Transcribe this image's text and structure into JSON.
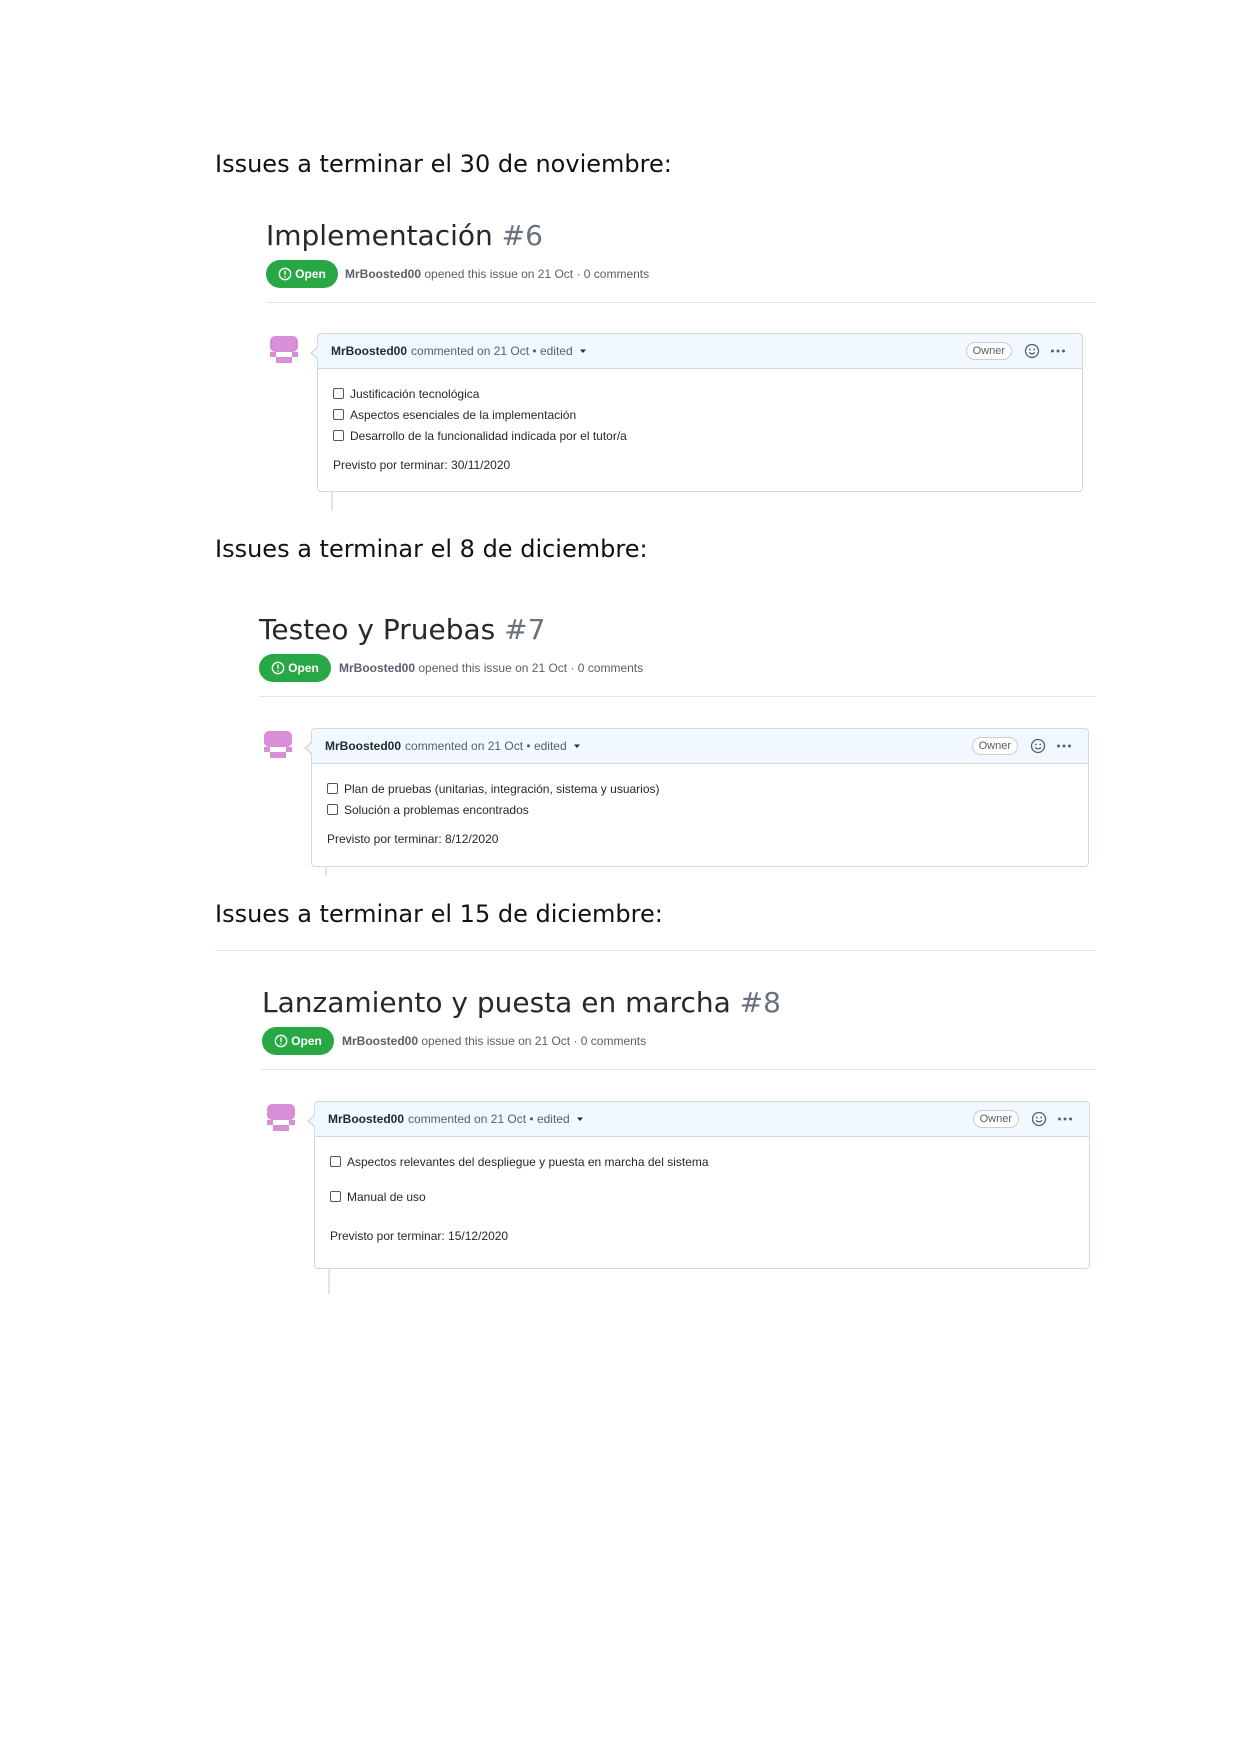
{
  "sections": [
    {
      "heading": "Issues a terminar el 30 de noviembre:",
      "issue": {
        "title": "Implementación",
        "number": "#6",
        "state": "Open",
        "author": "MrBoosted00",
        "meta": "opened this issue on 21 Oct · 0 comments",
        "comment_date": "commented on 21 Oct • edited",
        "role": "Owner",
        "tasks": [
          "Justificación tecnológica",
          "Aspectos esenciales de la implementación",
          "Desarrollo de la funcionalidad indicada por el tutor/a"
        ],
        "due": "Previsto por terminar: 30/11/2020"
      }
    },
    {
      "heading": "Issues a terminar el 8 de diciembre:",
      "issue": {
        "title": "Testeo y Pruebas",
        "number": "#7",
        "state": "Open",
        "author": "MrBoosted00",
        "meta": "opened this issue on 21 Oct · 0 comments",
        "comment_date": "commented on 21 Oct • edited",
        "role": "Owner",
        "tasks": [
          "Plan de pruebas (unitarias, integración, sistema y usuarios)",
          "Solución a problemas encontrados"
        ],
        "due": "Previsto por terminar: 8/12/2020"
      }
    },
    {
      "heading": "Issues a terminar el 15 de diciembre:",
      "issue": {
        "title": "Lanzamiento y puesta en marcha",
        "number": "#8",
        "state": "Open",
        "author": "MrBoosted00",
        "meta": "opened this issue on 21 Oct · 0 comments",
        "comment_date": "commented on 21 Oct • edited",
        "role": "Owner",
        "tasks": [
          "Aspectos relevantes del despliegue y puesta en marcha del sistema",
          "Manual de uso"
        ],
        "due": "Previsto por terminar: 15/12/2020"
      }
    }
  ],
  "colors": {
    "open_badge": "#28a745",
    "avatar": "#d98ed8",
    "comment_header": "#f1f8ff"
  }
}
